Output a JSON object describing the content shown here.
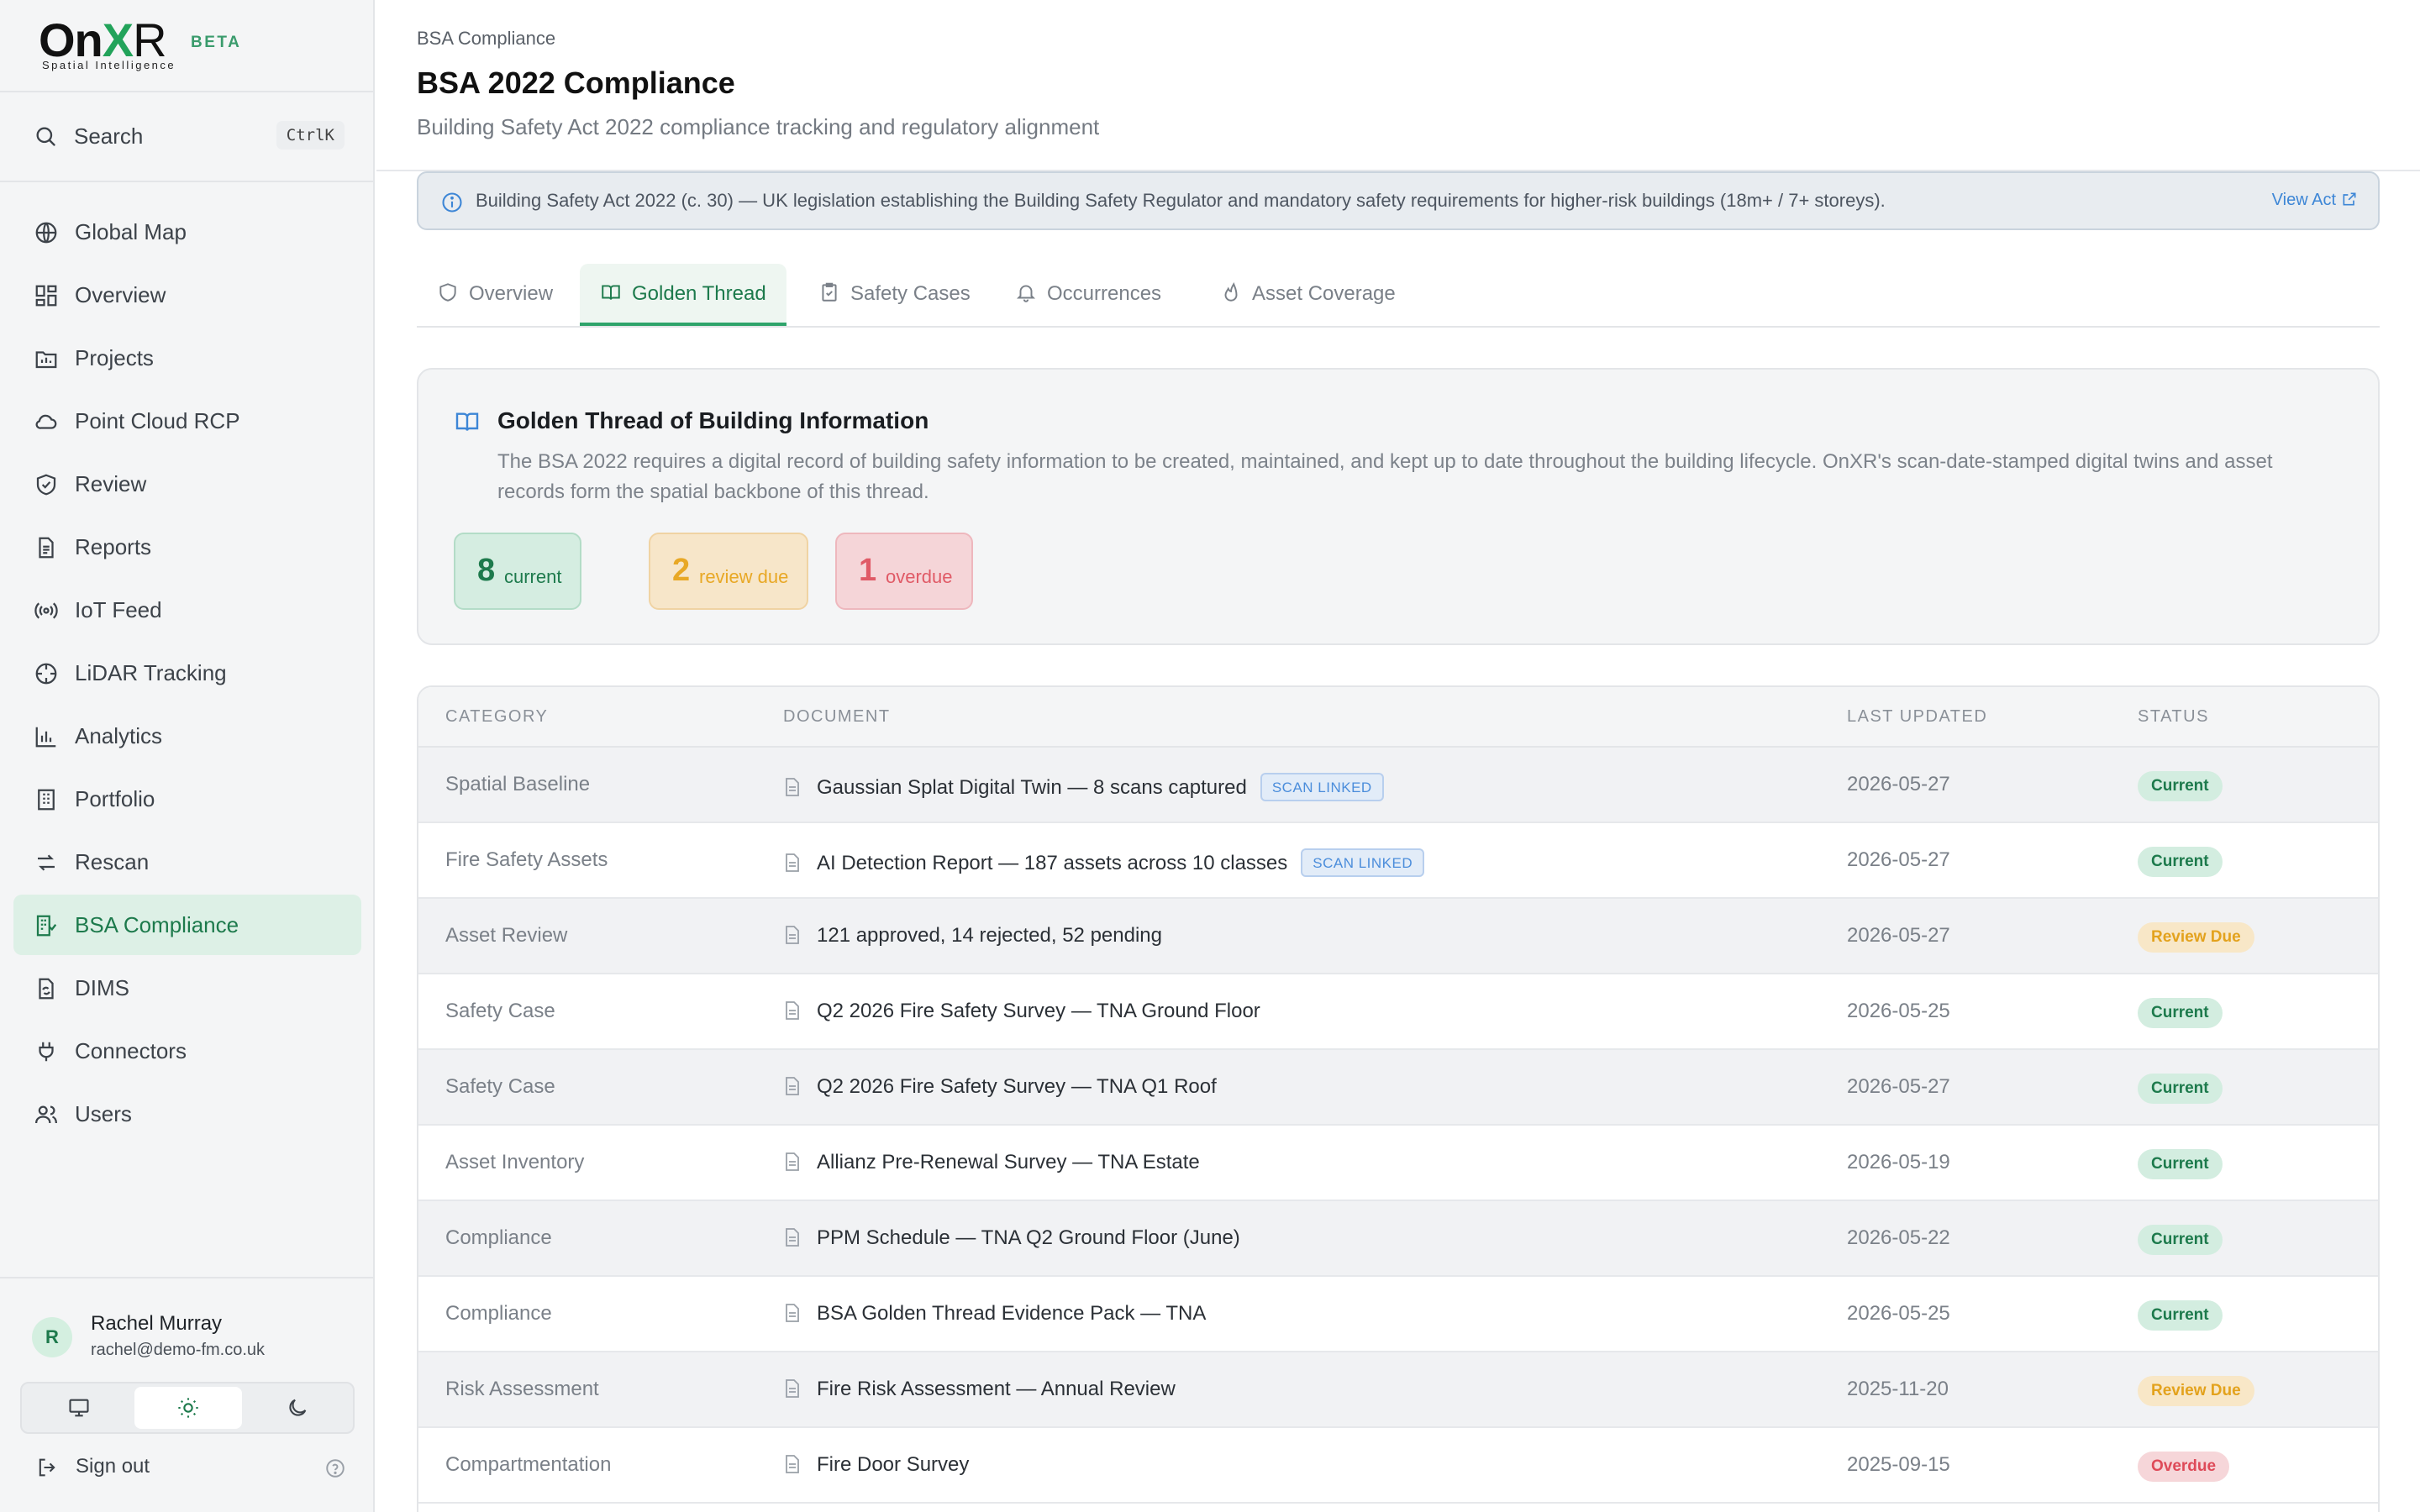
{
  "brand": {
    "logo_main": "On",
    "logo_x": "X",
    "logo_r": "R",
    "tagline": "Spatial Intelligence",
    "badge": "BETA"
  },
  "search": {
    "label": "Search",
    "shortcut": "CtrlK"
  },
  "nav": [
    {
      "label": "Global Map",
      "icon": "globe-icon"
    },
    {
      "label": "Overview",
      "icon": "dashboard-icon"
    },
    {
      "label": "Projects",
      "icon": "folder-chart-icon"
    },
    {
      "label": "Point Cloud RCP",
      "icon": "cloud-icon"
    },
    {
      "label": "Review",
      "icon": "shield-check-icon"
    },
    {
      "label": "Reports",
      "icon": "file-text-icon"
    },
    {
      "label": "IoT Feed",
      "icon": "radio-icon"
    },
    {
      "label": "LiDAR Tracking",
      "icon": "crosshair-icon"
    },
    {
      "label": "Analytics",
      "icon": "bar-chart-icon"
    },
    {
      "label": "Portfolio",
      "icon": "building-icon"
    },
    {
      "label": "Rescan",
      "icon": "refresh-icon"
    },
    {
      "label": "BSA Compliance",
      "icon": "building-check-icon",
      "active": true
    },
    {
      "label": "DIMS",
      "icon": "file-sync-icon"
    },
    {
      "label": "Connectors",
      "icon": "plug-icon"
    },
    {
      "label": "Users",
      "icon": "users-icon"
    }
  ],
  "user": {
    "initial": "R",
    "name": "Rachel Murray",
    "email": "rachel@demo-fm.co.uk"
  },
  "theme": {
    "selected": "light",
    "options": [
      "system",
      "light",
      "dark"
    ]
  },
  "signout": {
    "label": "Sign out"
  },
  "header": {
    "breadcrumb": "BSA Compliance",
    "title": "BSA 2022 Compliance",
    "subtitle": "Building Safety Act 2022 compliance tracking and regulatory alignment"
  },
  "banner": {
    "text": "Building Safety Act 2022 (c. 30) — UK legislation establishing the Building Safety Regulator and mandatory safety requirements for higher-risk buildings (18m+ / 7+ storeys).",
    "link": "View Act"
  },
  "tabs": [
    {
      "label": "Overview",
      "icon": "shield-icon"
    },
    {
      "label": "Golden Thread",
      "icon": "book-open-icon",
      "active": true
    },
    {
      "label": "Safety Cases",
      "icon": "clipboard-check-icon"
    },
    {
      "label": "Occurrences",
      "icon": "bell-icon"
    },
    {
      "label": "Asset Coverage",
      "icon": "flame-icon"
    }
  ],
  "golden_thread": {
    "title": "Golden Thread of Building Information",
    "description": "The BSA 2022 requires a digital record of building safety information to be created, maintained, and kept up to date throughout the building lifecycle. OnXR's scan-date-stamped digital twins and asset records form the spatial backbone of this thread.",
    "stats": {
      "current": {
        "value": "8",
        "label": "current"
      },
      "review": {
        "value": "2",
        "label": "review due"
      },
      "overdue": {
        "value": "1",
        "label": "overdue"
      }
    }
  },
  "table": {
    "columns": [
      "CATEGORY",
      "DOCUMENT",
      "LAST UPDATED",
      "STATUS"
    ],
    "rows": [
      {
        "category": "Spatial Baseline",
        "document": "Gaussian Splat Digital Twin — 8 scans captured",
        "badge": "SCAN LINKED",
        "updated": "2026-05-27",
        "status": "Current"
      },
      {
        "category": "Fire Safety Assets",
        "document": "AI Detection Report — 187 assets across 10 classes",
        "badge": "SCAN LINKED",
        "updated": "2026-05-27",
        "status": "Current"
      },
      {
        "category": "Asset Review",
        "document": "121 approved, 14 rejected, 52 pending",
        "badge": "",
        "updated": "2026-05-27",
        "status": "Review Due"
      },
      {
        "category": "Safety Case",
        "document": "Q2 2026 Fire Safety Survey — TNA Ground Floor",
        "badge": "",
        "updated": "2026-05-25",
        "status": "Current"
      },
      {
        "category": "Safety Case",
        "document": "Q2 2026 Fire Safety Survey — TNA Q1 Roof",
        "badge": "",
        "updated": "2026-05-27",
        "status": "Current"
      },
      {
        "category": "Asset Inventory",
        "document": "Allianz Pre-Renewal Survey — TNA Estate",
        "badge": "",
        "updated": "2026-05-19",
        "status": "Current"
      },
      {
        "category": "Compliance",
        "document": "PPM Schedule — TNA Q2 Ground Floor (June)",
        "badge": "",
        "updated": "2026-05-22",
        "status": "Current"
      },
      {
        "category": "Compliance",
        "document": "BSA Golden Thread Evidence Pack — TNA",
        "badge": "",
        "updated": "2026-05-25",
        "status": "Current"
      },
      {
        "category": "Risk Assessment",
        "document": "Fire Risk Assessment — Annual Review",
        "badge": "",
        "updated": "2025-11-20",
        "status": "Review Due"
      },
      {
        "category": "Compartmentation",
        "document": "Fire Door Survey",
        "badge": "",
        "updated": "2025-09-15",
        "status": "Overdue"
      }
    ]
  },
  "colors": {
    "accent": "#1d7a4c",
    "accent_bg": "#ddf0e6",
    "link": "#3d86d6",
    "warning": "#e3a21d",
    "danger": "#de4a58"
  }
}
